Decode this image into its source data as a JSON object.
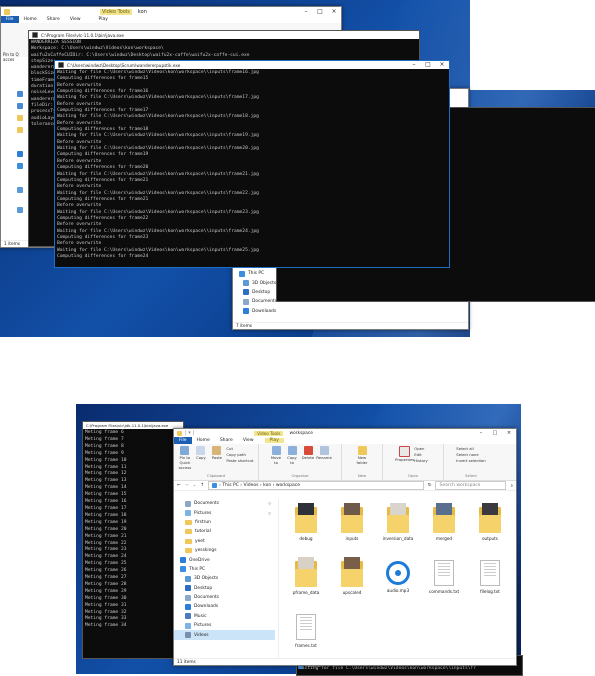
{
  "top": {
    "explorer_back": {
      "tabs": [
        "File",
        "Home",
        "Share",
        "View",
        "Play"
      ],
      "manage_tab": "Video Tools",
      "title_frag": "kon",
      "nav_side": [
        "Pin to Q",
        "acces"
      ],
      "status": "1 items"
    },
    "cmd_main": {
      "title": "C:\\Program Files\\vlc-11.0.1\\bin\\java.exe",
      "lines": [
        "WANDERRIZA SESSION",
        "Workspace: C:\\Users\\windwz\\Videos\\kon\\workspace\\",
        "waifu2xCaffeCUIDir: C:\\Users\\windwz\\Desktop\\waifu2x-caffe\\waifu2x-caffe-cui.exe",
        "stepSize: ",
        "wanderer@...",
        "blockSize",
        "timeFrame",
        "duration:",
        "noiseLevel",
        "wanderer@",
        "fileDir:",
        "processTy",
        "audioLayer",
        "tolerance"
      ]
    },
    "cmd_overlay": {
      "title": "C:\\Users\\windwz\\Desktop\\Scrum\\wandererpupstik.exe",
      "lines": [
        "Waiting for file C:\\Users\\windwz\\Videos\\kon\\workspace\\\\inputs\\frame16.jpg",
        "Computing differences for frame15",
        "Before overwrite",
        "Computing differences for frame16",
        "Waiting for file C:\\Users\\windwz\\Videos\\kon\\workspace\\\\inputs\\frame17.jpg",
        "Before overwrite",
        "Computing differences for frame17",
        "Waiting for file C:\\Users\\windwz\\Videos\\kon\\workspace\\\\inputs\\frame18.jpg",
        "Before overwrite",
        "Computing differences for frame18",
        "Waiting for file C:\\Users\\windwz\\Videos\\kon\\workspace\\\\inputs\\frame19.jpg",
        "Before overwrite",
        "Waiting for file C:\\Users\\windwz\\Videos\\kon\\workspace\\\\inputs\\frame20.jpg",
        "Computing differences for frame19",
        "Before overwrite",
        "Computing differences for frame20",
        "Waiting for file C:\\Users\\windwz\\Videos\\kon\\workspace\\\\inputs\\frame21.jpg",
        "Computing differences for frame21",
        "Before overwrite",
        "Waiting for file C:\\Users\\windwz\\Videos\\kon\\workspace\\\\inputs\\frame22.jpg",
        "Computing differences for frame21",
        "Before overwrite",
        "Waiting for file C:\\Users\\windwz\\Videos\\kon\\workspace\\\\inputs\\frame23.jpg",
        "Computing differences for frame22",
        "Before overwrite",
        "Waiting for file C:\\Users\\windwz\\Videos\\kon\\workspace\\\\inputs\\frame24.jpg",
        "Computing differences for frame23",
        "Before overwrite",
        "Waiting for file C:\\Users\\windwz\\Videos\\kon\\workspace\\\\inputs\\frame25.jpg",
        "Computing differences for frame24"
      ]
    },
    "explorer_front": {
      "nav": [
        "This PC",
        "3D Objects",
        "Desktop",
        "Documents",
        "Downloads"
      ],
      "status": "7 items"
    }
  },
  "bottom": {
    "cmd": {
      "title": "C:\\Program Files\\vlc\\jdk-11.0.1\\bin\\java.exe",
      "lines": [
        "Meting frame 6",
        "Meting frame 7",
        "Meting frame 8",
        "Meting frame 9",
        "Meting frame 10",
        "Meting frame 11",
        "Meting frame 12",
        "Meting frame 13",
        "Meting frame 14",
        "Meting frame 15",
        "Meting frame 16",
        "Meting frame 17",
        "Meting frame 18",
        "Meting frame 19",
        "Meting frame 20",
        "Meting frame 21",
        "Meting frame 22",
        "Meting frame 23",
        "Meting frame 24",
        "Meting frame 25",
        "Meting frame 26",
        "Meting frame 27",
        "Meting frame 28",
        "Meting frame 29",
        "Meting frame 30",
        "Meting frame 31",
        "Meting frame 32",
        "Meting frame 33",
        "Meting frame 34"
      ]
    },
    "explorer": {
      "manage_tab": "Video Tools",
      "title": "workspace",
      "tabs": [
        "File",
        "Home",
        "Share",
        "View",
        "Play"
      ],
      "ribbon": {
        "clipboard": {
          "pin": "Pin to Quick access",
          "copy": "Copy",
          "paste": "Paste",
          "cut": "Cut",
          "copy_path": "Copy path",
          "paste_shortcut": "Paste shortcut",
          "group": "Clipboard"
        },
        "organize": {
          "move": "Move to",
          "copy": "Copy to",
          "delete": "Delete",
          "rename": "Rename",
          "group": "Organize"
        },
        "new": {
          "new_folder": "New folder",
          "group": "New"
        },
        "open": {
          "properties": "Properties",
          "open": "Open",
          "edit": "Edit",
          "history": "History",
          "group": "Open"
        },
        "select": {
          "select_all": "Select all",
          "select_none": "Select none",
          "invert": "Invert selection",
          "group": "Select"
        }
      },
      "breadcrumb": [
        "This PC",
        "Videos",
        "kon",
        "workspace"
      ],
      "search_placeholder": "Search workspace",
      "nav": [
        {
          "label": "Documents",
          "type": "docs",
          "indent": true
        },
        {
          "label": "Pictures",
          "type": "pics",
          "indent": true
        },
        {
          "label": "firstrun",
          "type": "folder",
          "indent": true
        },
        {
          "label": "tutorial",
          "type": "folder",
          "indent": true
        },
        {
          "label": "yeet",
          "type": "folder",
          "indent": true
        },
        {
          "label": "yesskings",
          "type": "folder",
          "indent": true
        },
        {
          "label": "OneDrive",
          "type": "cloud",
          "indent": false
        },
        {
          "label": "This PC",
          "type": "pc",
          "indent": false
        },
        {
          "label": "3D Objects",
          "type": "obj3d",
          "indent": true
        },
        {
          "label": "Desktop",
          "type": "desktop",
          "indent": true
        },
        {
          "label": "Documents",
          "type": "docs",
          "indent": true
        },
        {
          "label": "Downloads",
          "type": "down",
          "indent": true
        },
        {
          "label": "Music",
          "type": "music",
          "indent": true
        },
        {
          "label": "Pictures",
          "type": "pics",
          "indent": true
        },
        {
          "label": "Videos",
          "type": "videos",
          "indent": true,
          "selected": true
        }
      ],
      "files": [
        {
          "name": "debug",
          "kind": "folder-img",
          "tint": "#2f3138"
        },
        {
          "name": "inputs",
          "kind": "folder-img",
          "tint": "#6e5a4a"
        },
        {
          "name": "inversion_data",
          "kind": "folder-img",
          "tint": "#d9d5cc"
        },
        {
          "name": "merged",
          "kind": "folder-img",
          "tint": "#5a6f8e"
        },
        {
          "name": "outputs",
          "kind": "folder-img",
          "tint": "#3b3b3f"
        },
        {
          "name": "pframe_data",
          "kind": "folder-img",
          "tint": "#d8d2c6"
        },
        {
          "name": "upscaled",
          "kind": "folder-img",
          "tint": "#7a5f48"
        },
        {
          "name": "audio.mp3",
          "kind": "audio"
        },
        {
          "name": "commands.txt",
          "kind": "text"
        },
        {
          "name": "filelog.txt",
          "kind": "text"
        },
        {
          "name": "frames.txt",
          "kind": "text"
        }
      ],
      "status": "11 items"
    },
    "cmd_peek": {
      "line1": "... seese",
      "line2": "waiting for file C:\\Users\\windwz\\Videos\\kon\\workspace\\\\inputs\\fr"
    }
  }
}
